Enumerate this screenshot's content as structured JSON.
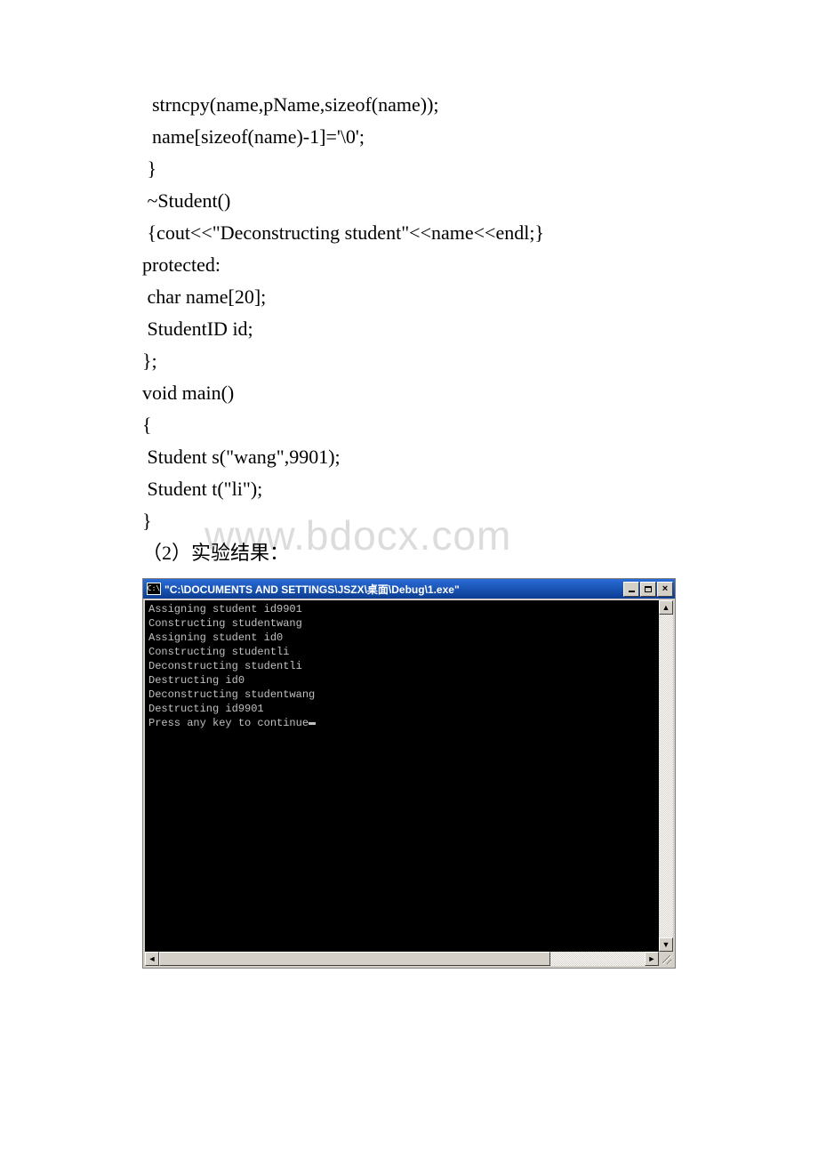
{
  "code": {
    "l1": "  strncpy(name,pName,sizeof(name));",
    "l2": "  name[sizeof(name)-1]='\\0';",
    "l3": " }",
    "l4": " ~Student()",
    "l5": " {cout<<\"Deconstructing student\"<<name<<endl;}",
    "l6": "protected:",
    "l7": " char name[20];",
    "l8": " StudentID id;",
    "l9": "};",
    "l10": "void main()",
    "l11": "{",
    "l12": " Student s(\"wang\",9901);",
    "l13": " Student t(\"li\");",
    "l14": "}"
  },
  "section_label": "（2）实验结果：",
  "watermark": "www.bdocx.com",
  "console": {
    "icon_text": "C:\\",
    "title": "\"C:\\DOCUMENTS AND SETTINGS\\JSZX\\桌面\\Debug\\1.exe\"",
    "lines": [
      "Assigning student id9901",
      "Constructing studentwang",
      "Assigning student id0",
      "Constructing studentli",
      "Deconstructing studentli",
      "Destructing id0",
      "Deconstructing studentwang",
      "Destructing id9901",
      "Press any key to continue"
    ],
    "buttons": {
      "close": "×"
    },
    "arrows": {
      "up": "▲",
      "down": "▼",
      "left": "◄",
      "right": "►"
    }
  }
}
